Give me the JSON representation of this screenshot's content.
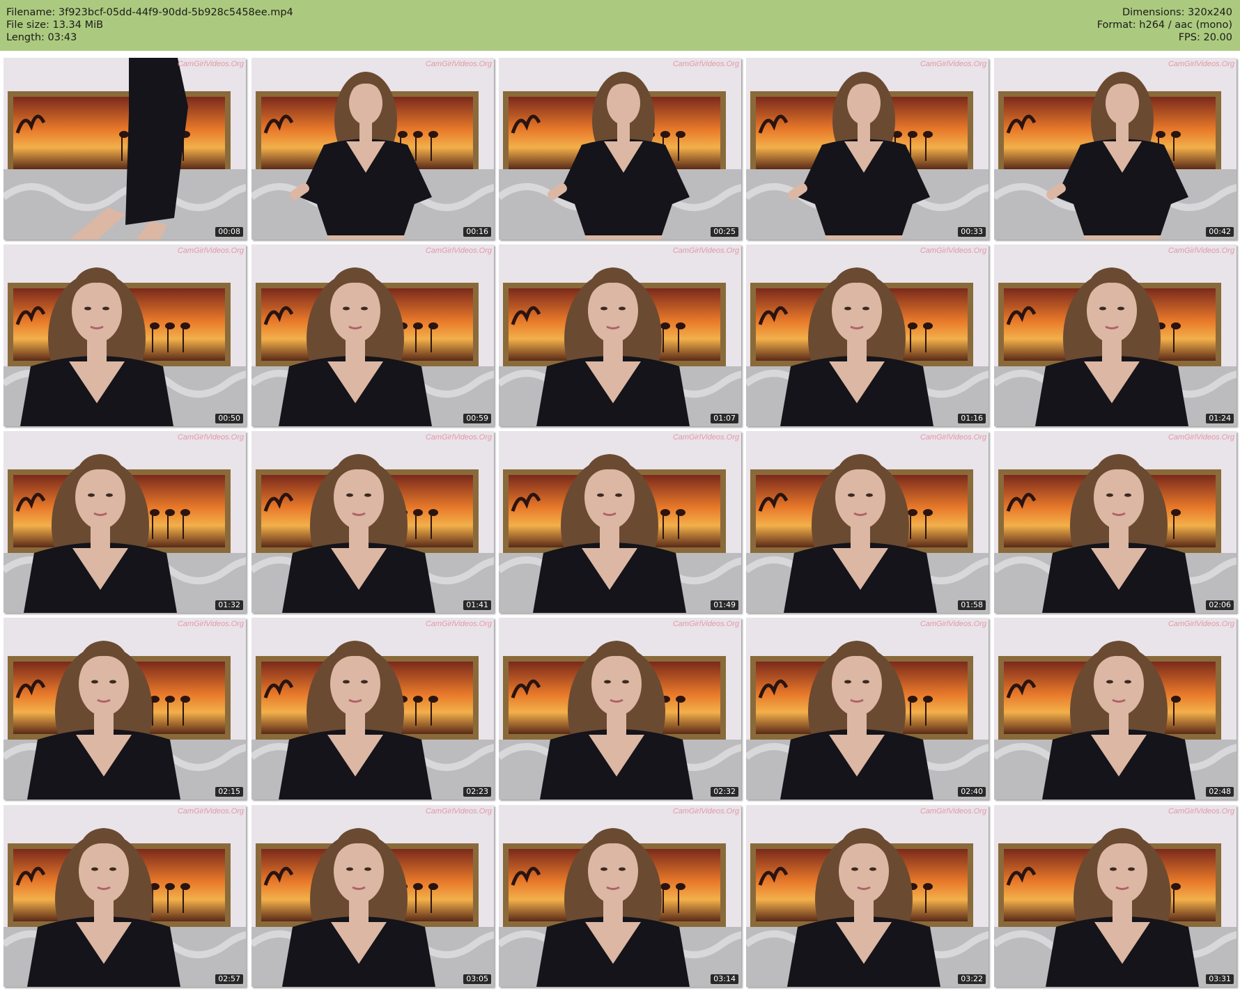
{
  "header": {
    "filename_line": "Filename: 3f923bcf-05dd-44f9-90dd-5b928c5458ee.mp4",
    "filesize_line": "File size: 13.34 MiB",
    "length_line": "Length: 03:43",
    "dimensions_line": "Dimensions: 320x240",
    "format_line": "Format: h264 / aac (mono)",
    "fps_line": "FPS: 20.00"
  },
  "watermark": "CamGirlVideos.Org",
  "colors": {
    "header_bg": "#acca7f",
    "wall": "#e8e4e9",
    "painting_orange": "#e8792a",
    "dress": "#14141a",
    "hair": "#6b4a32",
    "skin": "#dcb7a3",
    "sofa": "#bcbcbe"
  },
  "thumbnails": [
    {
      "time": "00:08"
    },
    {
      "time": "00:16"
    },
    {
      "time": "00:25"
    },
    {
      "time": "00:33"
    },
    {
      "time": "00:42"
    },
    {
      "time": "00:50"
    },
    {
      "time": "00:59"
    },
    {
      "time": "01:07"
    },
    {
      "time": "01:16"
    },
    {
      "time": "01:24"
    },
    {
      "time": "01:32"
    },
    {
      "time": "01:41"
    },
    {
      "time": "01:49"
    },
    {
      "time": "01:58"
    },
    {
      "time": "02:06"
    },
    {
      "time": "02:15"
    },
    {
      "time": "02:23"
    },
    {
      "time": "02:32"
    },
    {
      "time": "02:40"
    },
    {
      "time": "02:48"
    },
    {
      "time": "02:57"
    },
    {
      "time": "03:05"
    },
    {
      "time": "03:14"
    },
    {
      "time": "03:22"
    },
    {
      "time": "03:31"
    }
  ]
}
